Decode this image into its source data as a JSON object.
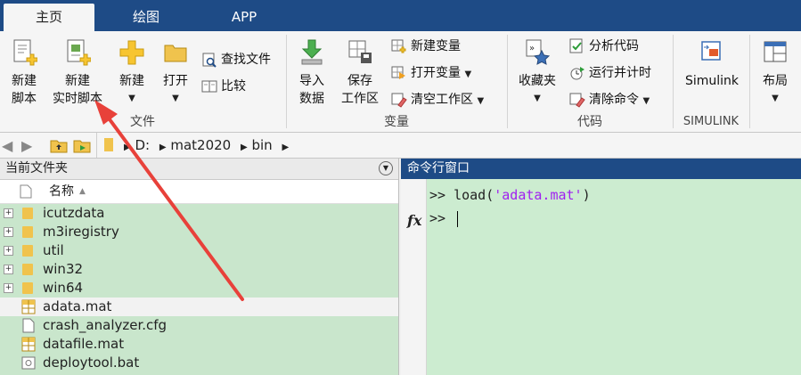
{
  "tabs": [
    {
      "label": "主页",
      "active": true
    },
    {
      "label": "绘图",
      "active": false
    },
    {
      "label": "APP",
      "active": false
    }
  ],
  "file_group": {
    "label": "文件",
    "new_script": {
      "line1": "新建",
      "line2": "脚本"
    },
    "new_live_script": {
      "line1": "新建",
      "line2": "实时脚本"
    },
    "new": "新建",
    "open": "打开",
    "find_files": "查找文件",
    "compare": "比较"
  },
  "variable_group": {
    "label": "变量",
    "import_data": {
      "line1": "导入",
      "line2": "数据"
    },
    "save_workspace": {
      "line1": "保存",
      "line2": "工作区"
    },
    "new_variable": "新建变量",
    "open_variable": "打开变量",
    "clear_workspace": "清空工作区"
  },
  "code_group": {
    "label": "代码",
    "favorites": "收藏夹",
    "analyze_code": "分析代码",
    "run_and_time": "运行并计时",
    "clear_commands": "清除命令"
  },
  "simulink_group": {
    "label": "SIMULINK",
    "simulink": "Simulink"
  },
  "layout": "布局",
  "address": {
    "drive": "D:",
    "folder1": "mat2020",
    "folder2": "bin"
  },
  "current_folder": {
    "title": "当前文件夹",
    "column_name": "名称",
    "items": [
      {
        "name": "icutzdata",
        "type": "folder"
      },
      {
        "name": "m3iregistry",
        "type": "folder"
      },
      {
        "name": "util",
        "type": "folder"
      },
      {
        "name": "win32",
        "type": "folder"
      },
      {
        "name": "win64",
        "type": "folder"
      },
      {
        "name": "adata.mat",
        "type": "mat",
        "selected": true
      },
      {
        "name": "crash_analyzer.cfg",
        "type": "cfg"
      },
      {
        "name": "datafile.mat",
        "type": "mat"
      },
      {
        "name": "deploytool.bat",
        "type": "bat"
      }
    ]
  },
  "command_window": {
    "title": "命令行窗口",
    "prompt": ">>",
    "line1_cmd": "load(",
    "line1_arg": "'adata.mat'",
    "line1_end": ")",
    "fx": "fx"
  },
  "colors": {
    "accent": "#1e4b86",
    "panel_green": "#c9e6cc",
    "annotation_arrow": "#e8413a"
  }
}
